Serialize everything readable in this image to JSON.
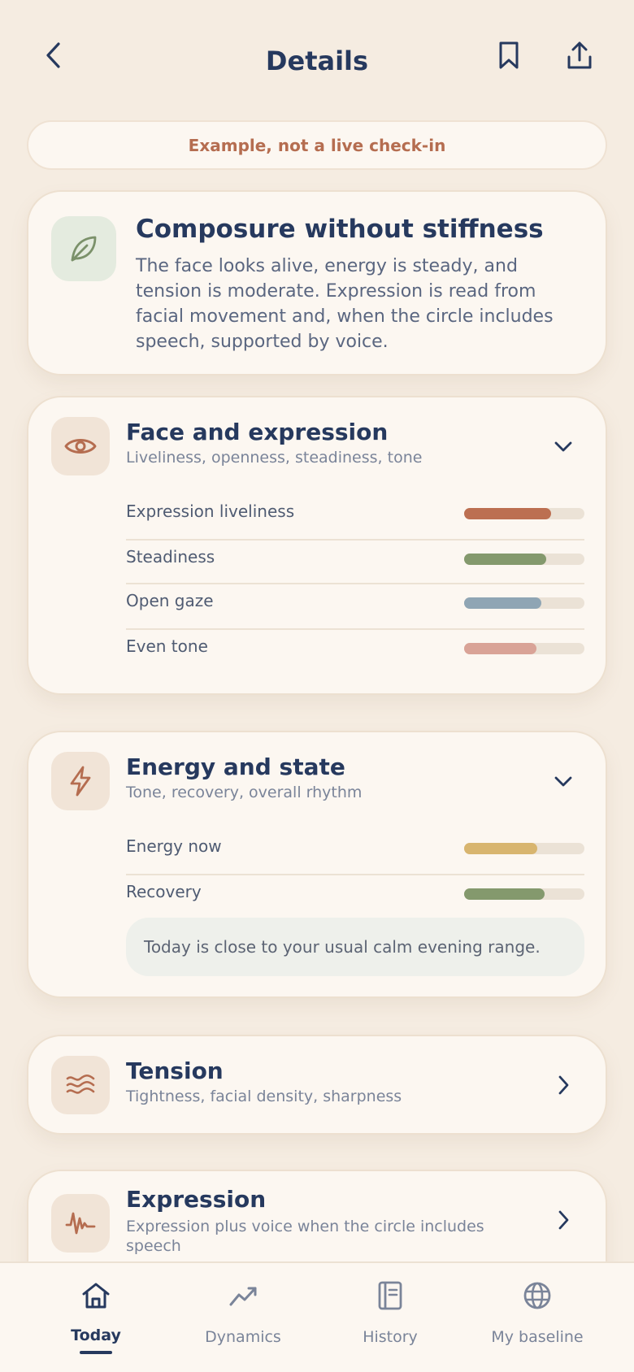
{
  "header": {
    "title": "Details",
    "back_icon": "chevron-left-icon",
    "bookmark_icon": "bookmark-icon",
    "share_icon": "share-icon"
  },
  "banner": {
    "text": "Example, not a live check-in"
  },
  "summary": {
    "icon": "leaf-icon",
    "title": "Composure without stiffness",
    "description": "The face looks alive, energy is steady, and tension is moderate. Expression is read from facial movement and, when the circle includes speech, supported by voice."
  },
  "sections": [
    {
      "icon": "eye-icon",
      "title": "Face and expression",
      "subtitle": "Liveliness, openness, steadiness, tone",
      "expanded": true,
      "metrics": [
        {
          "label": "Expression liveliness",
          "value": 0.72,
          "color": "#bc6f51"
        },
        {
          "label": "Steadiness",
          "value": 0.68,
          "color": "#84996d"
        },
        {
          "label": "Open gaze",
          "value": 0.64,
          "color": "#8fa5b4"
        },
        {
          "label": "Even tone",
          "value": 0.6,
          "color": "#d9a397"
        }
      ]
    },
    {
      "icon": "lightning-icon",
      "title": "Energy and state",
      "subtitle": "Tone, recovery, overall rhythm",
      "expanded": true,
      "metrics": [
        {
          "label": "Energy now",
          "value": 0.61,
          "color": "#d8b56f"
        },
        {
          "label": "Recovery",
          "value": 0.67,
          "color": "#84996d"
        }
      ],
      "note": "Today is close to your usual calm evening range."
    },
    {
      "icon": "waves-icon",
      "title": "Tension",
      "subtitle": "Tightness, facial density, sharpness",
      "expanded": false
    },
    {
      "icon": "waveform-icon",
      "title": "Expression",
      "subtitle": "Expression plus voice when the circle includes speech",
      "expanded": false
    }
  ],
  "tabs": [
    {
      "label": "Today",
      "icon": "home-icon",
      "active": true
    },
    {
      "label": "Dynamics",
      "icon": "trend-icon",
      "active": false
    },
    {
      "label": "History",
      "icon": "journal-icon",
      "active": false
    },
    {
      "label": "My baseline",
      "icon": "globe-icon",
      "active": false
    }
  ],
  "colors": {
    "background": "#f5ece1",
    "card": "#fcf7f1",
    "navy": "#26395e",
    "accent": "#b56d50"
  }
}
